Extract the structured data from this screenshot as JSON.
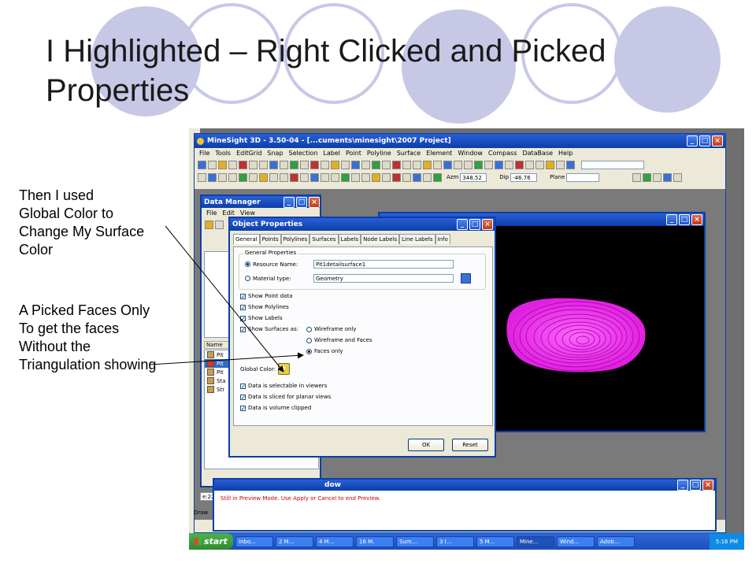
{
  "slide": {
    "title": "I Highlighted – Right Clicked and Picked Properties",
    "note1": [
      "Then I used",
      "Global Color to",
      "Change My Surface",
      "Color"
    ],
    "note2": [
      "A Picked Faces Only",
      "To get the faces",
      "Without the",
      "Triangulation showing"
    ]
  },
  "app": {
    "title": "MineSight 3D  - 3.50-04 - [...cuments\\minesight\\2007 Project]",
    "menu": [
      "File",
      "Tools",
      "EditGrid",
      "Snap",
      "Selection",
      "Label",
      "Point",
      "Polyline",
      "Surface",
      "Element",
      "Window",
      "Compass",
      "DataBase",
      "Help"
    ],
    "azm_label": "Azm",
    "azm_value": "348.52",
    "dip_label": "Dip",
    "dip_value": "-46.76",
    "plane_label": "Plane"
  },
  "data_manager": {
    "title": "Data Manager",
    "menu": [
      "File",
      "Edit",
      "View"
    ],
    "name_header": "Name",
    "items": [
      "Pit",
      "Pit",
      "Pit",
      "Sta",
      "Str"
    ],
    "path_value": "e:224(",
    "draw_label": "Draw"
  },
  "object_properties": {
    "title": "Object Properties",
    "tabs": [
      "General",
      "Points",
      "Polylines",
      "Surfaces",
      "Labels",
      "Node Labels",
      "Line Labels",
      "Info"
    ],
    "group_label": "General Properties",
    "resource_label": "Resource Name:",
    "resource_value": "Pit1detailsurface1",
    "material_label": "Material type:",
    "material_value": "Geometry",
    "show_point_data": "Show Point data",
    "show_polylines": "Show Polylines",
    "show_labels": "Show Labels",
    "show_surfaces_as": "Show Surfaces as:",
    "surface_options": [
      "Wireframe only",
      "Wireframe and Faces",
      "Faces only"
    ],
    "global_color_label": "Global Color:",
    "data_selectable": "Data is selectable in viewers",
    "data_sliced": "Data is sliced for planar views",
    "data_clipped": "Data is volume clipped",
    "ok_label": "OK",
    "reset_label": "Reset"
  },
  "message_window": {
    "title_fragment": "dow",
    "message": "Still in Preview Mode. Use Apply or Cancel to end Preview."
  },
  "taskbar": {
    "start_label": "start",
    "items": [
      "Inbo...",
      "2 M...",
      "4 M...",
      "16 M.",
      "Sum...",
      "3 I...",
      "5 M...",
      "Mine...",
      "Wind...",
      "Adob..."
    ],
    "clock": "5:16 PM"
  },
  "colors": {
    "surface": "#ff33ff",
    "xp_blue": "#0b3fa8",
    "circle": "#c7c8e6",
    "message_text": "#cc0000"
  }
}
